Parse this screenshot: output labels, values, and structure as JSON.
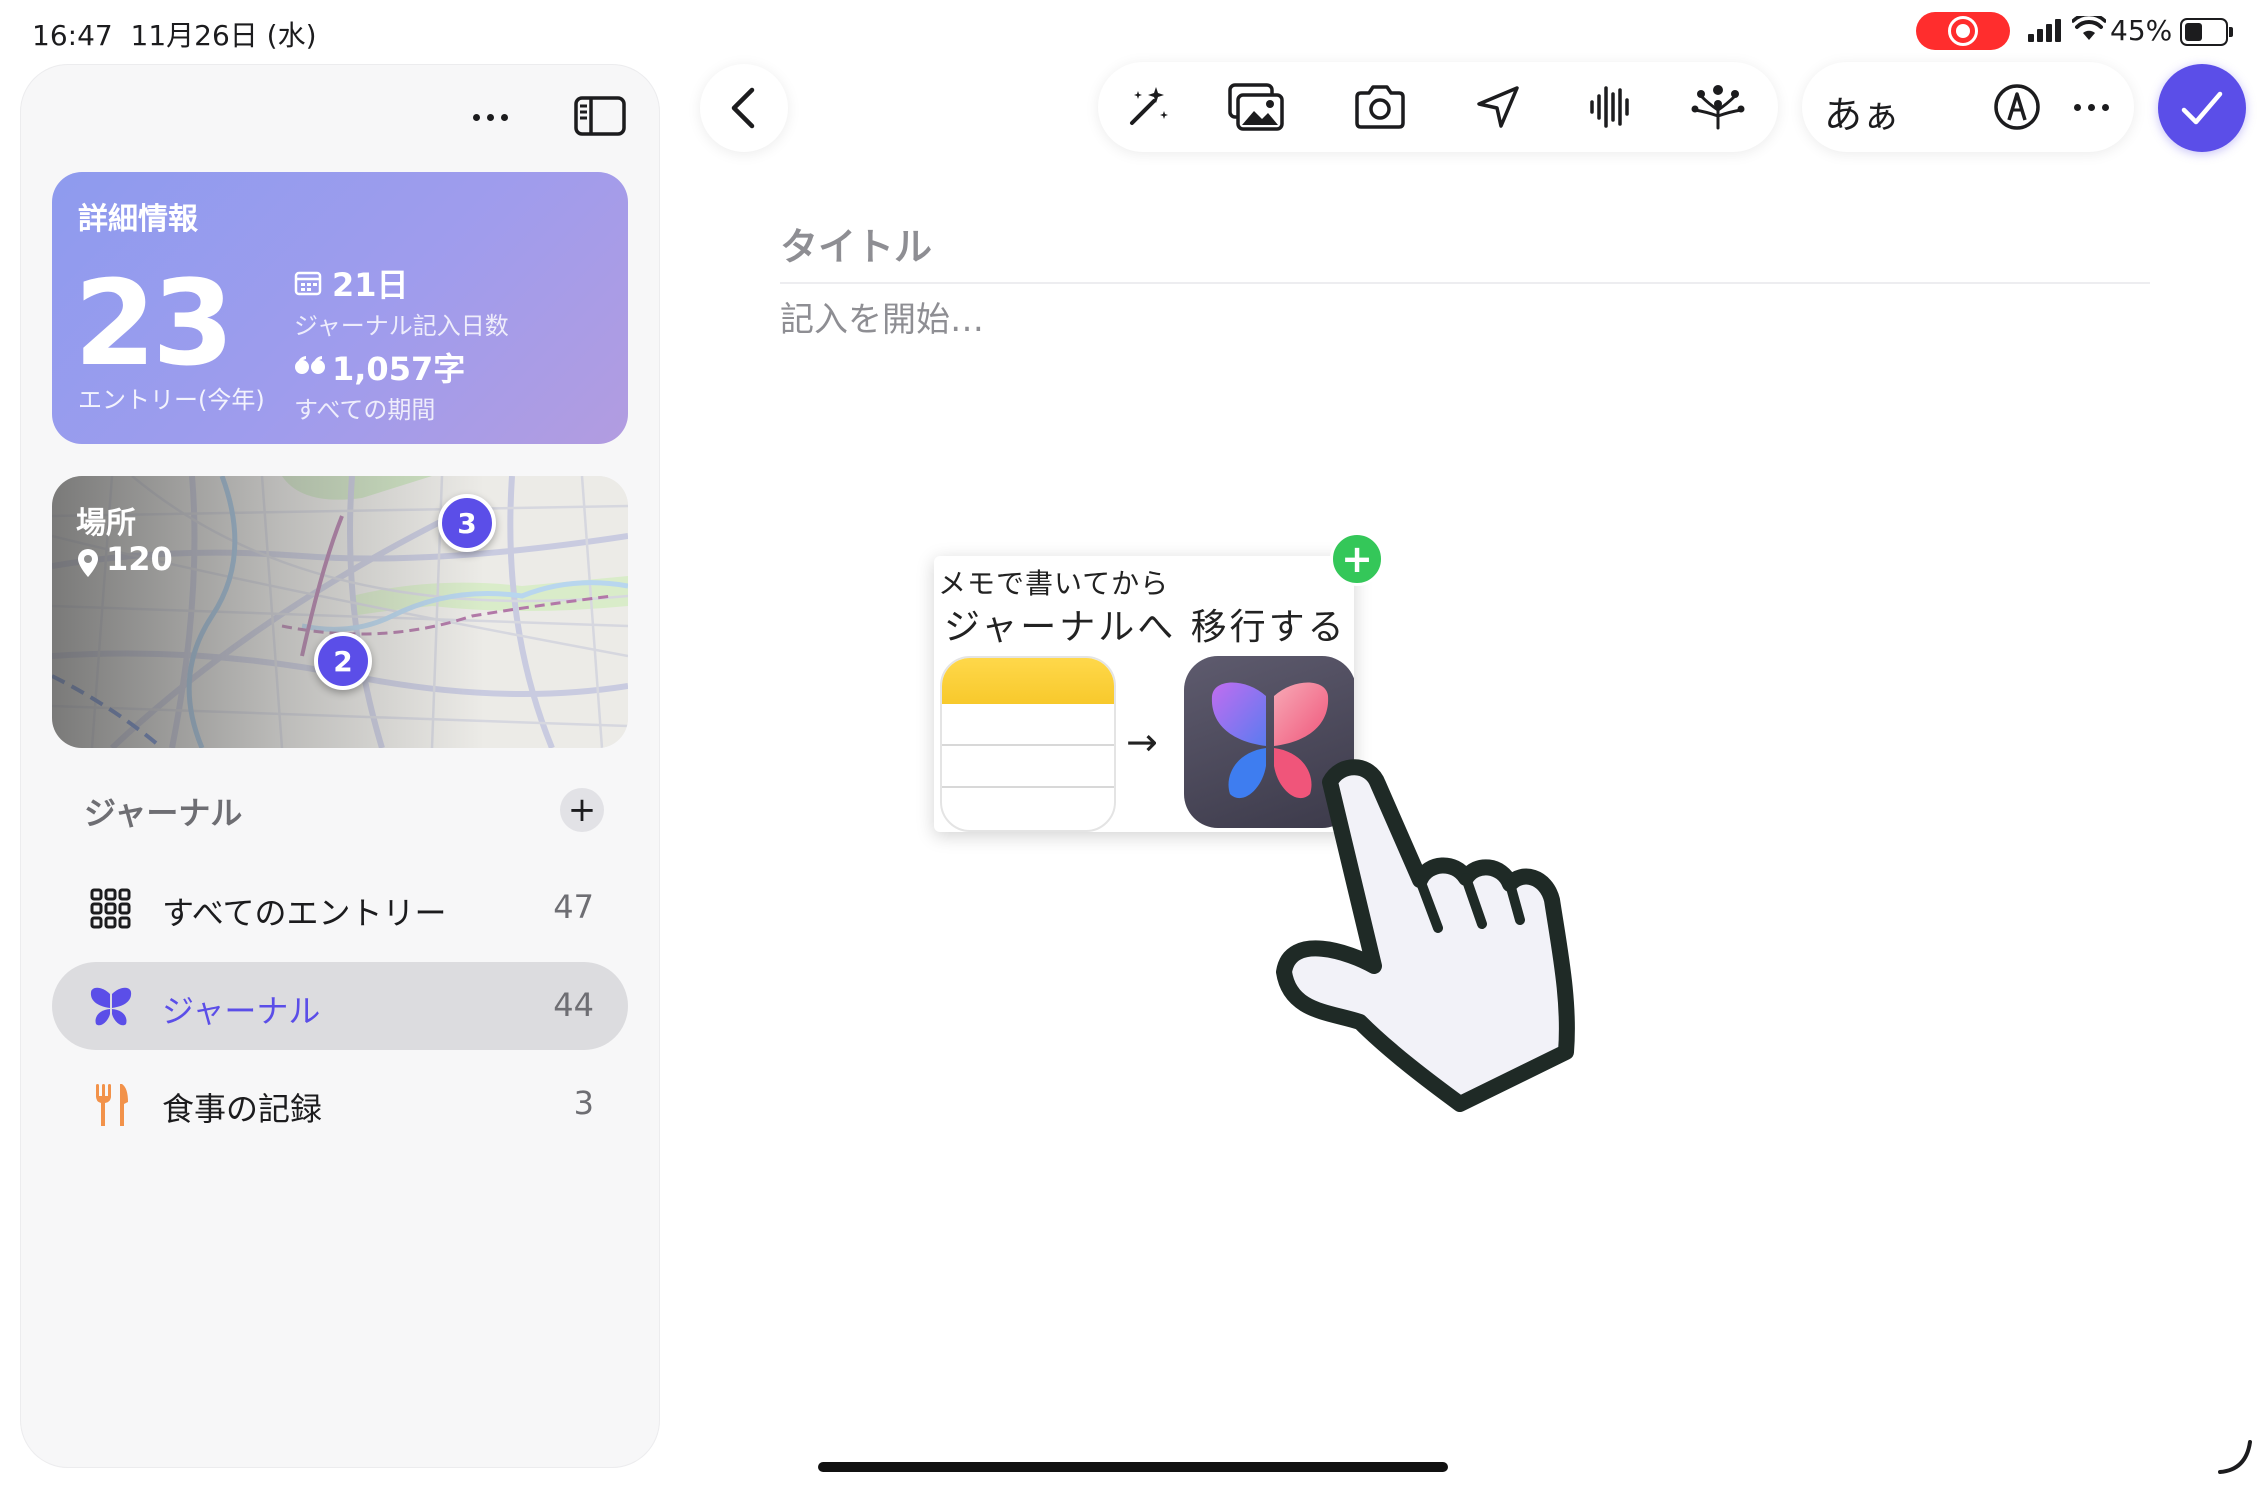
{
  "status_bar": {
    "time": "16:47",
    "date": "11月26日 (水)",
    "battery_percent": "45%",
    "battery_level": 0.45,
    "recording_color": "#ff2d2d"
  },
  "sidebar": {
    "more_icon": "ellipsis-icon",
    "toggle_icon": "sidebar-toggle-icon",
    "details_card": {
      "title": "詳細情報",
      "entries_count": "23",
      "entries_label": "エントリー(今年)",
      "days_value": "21日",
      "days_label": "ジャーナル記入日数",
      "words_value": "1,057字",
      "words_label": "すべての期間"
    },
    "places_card": {
      "title": "場所",
      "count": "120",
      "markers": [
        "3",
        "2"
      ]
    },
    "journal_section": {
      "heading": "ジャーナル",
      "add_label": "+",
      "items": [
        {
          "label": "すべてのエントリー",
          "count": "47",
          "icon": "grid-icon"
        },
        {
          "label": "ジャーナル",
          "count": "44",
          "icon": "butterfly-icon",
          "selected": true
        },
        {
          "label": "食事の記録",
          "count": "3",
          "icon": "fork-knife-icon"
        }
      ]
    }
  },
  "toolbar": {
    "icons": [
      "magic-wand-icon",
      "photo-library-icon",
      "camera-icon",
      "location-icon",
      "audio-waveform-icon",
      "suggestions-icon"
    ],
    "text_format_label": "あぁ",
    "markup_icon": "markup-pen-icon",
    "more_icon": "ellipsis-icon",
    "done_icon": "checkmark-icon",
    "accent_color": "#5b4ee8"
  },
  "editor": {
    "title_placeholder": "タイトル",
    "body_placeholder": "記入を開始…"
  },
  "drag_preview": {
    "line1": "メモで書いてから",
    "line2": "ジャーナルへ 移行する",
    "arrow": "→",
    "left_icon": "notes-app-icon",
    "right_icon": "journal-app-icon",
    "drop_badge": "+",
    "drop_color": "#34c759"
  }
}
